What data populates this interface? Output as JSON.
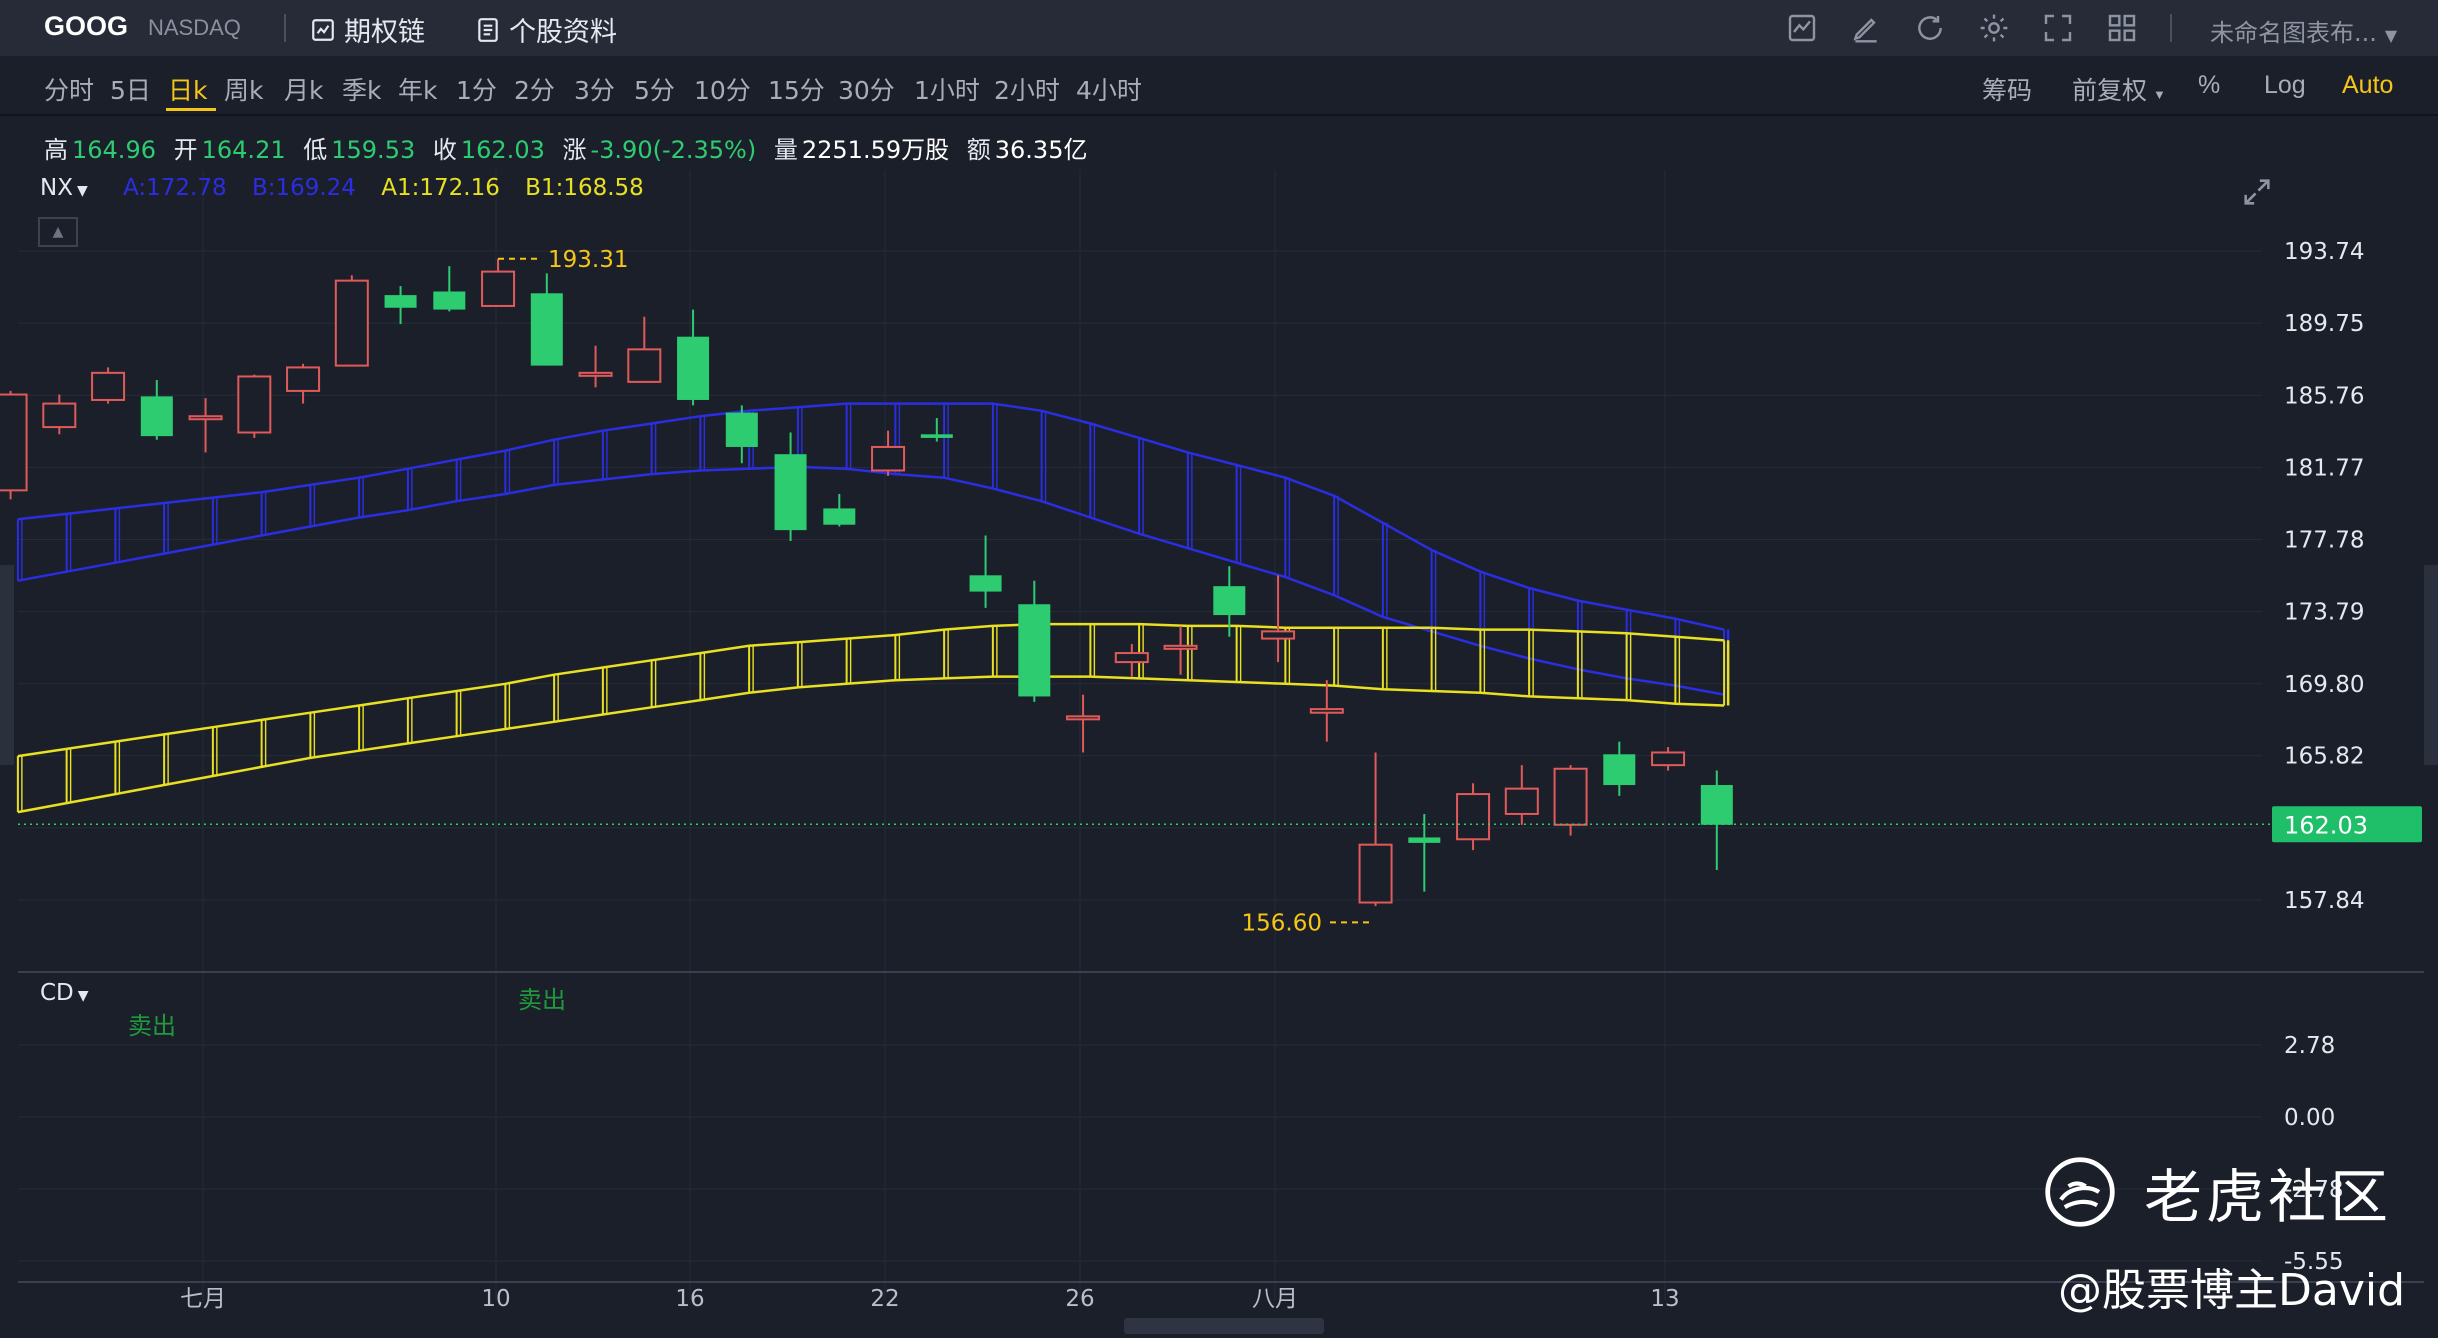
{
  "header": {
    "symbol": "GOOG",
    "exchange": "NASDAQ",
    "options_chain": "期权链",
    "profile": "个股资料",
    "layout_name": "未命名图表布...",
    "icons": [
      "indicator-icon",
      "draw-icon",
      "refresh-icon",
      "settings-icon",
      "fullscreen-icon",
      "layout-grid-icon"
    ]
  },
  "periods": [
    "分时",
    "5日",
    "日k",
    "周k",
    "月k",
    "季k",
    "年k",
    "1分",
    "2分",
    "3分",
    "5分",
    "10分",
    "15分",
    "30分",
    "1小时",
    "2小时",
    "4小时"
  ],
  "active_period": "日k",
  "right_tools": {
    "chips": "筹码",
    "adjust": "前复权",
    "percent": "%",
    "log": "Log",
    "auto": "Auto"
  },
  "quote": {
    "high_label": "高",
    "high": "164.96",
    "open_label": "开",
    "open": "164.21",
    "low_label": "低",
    "low": "159.53",
    "close_label": "收",
    "close": "162.03",
    "change_label": "涨",
    "change": "-3.90(-2.35%)",
    "volume_label": "量",
    "volume": "2251.59万股",
    "amount_label": "额",
    "amount": "36.35亿"
  },
  "indicator": {
    "name": "NX",
    "a": "A:172.78",
    "b": "B:169.24",
    "a1": "A1:172.16",
    "b1": "B1:168.58"
  },
  "sub_indicator": {
    "name": "CD",
    "signals": [
      "卖出",
      "卖出"
    ]
  },
  "price_axis": [
    "193.74",
    "189.75",
    "185.76",
    "181.77",
    "177.78",
    "173.79",
    "169.80",
    "165.82",
    "161.83",
    "157.84"
  ],
  "last_price": "162.03",
  "cd_axis": [
    "2.78",
    "0.00",
    "-2.78",
    "-5.55"
  ],
  "x_labels": [
    "七月",
    "10",
    "16",
    "22",
    "26",
    "八月",
    "13"
  ],
  "annotations": {
    "high_mark": "193.31",
    "low_mark": "156.60"
  },
  "watermark": {
    "brand": "老虎社区",
    "author": "@股票博主David"
  },
  "colors": {
    "up": "#e05a5a",
    "down": "#2ecc71",
    "band_blue": "#2a2ee0",
    "band_yellow": "#e8e020",
    "accent": "#f5c518"
  },
  "chart_data": {
    "type": "candlestick",
    "ylim": [
      155.0,
      195.0
    ],
    "candles": [
      {
        "o": 180.5,
        "h": 186.0,
        "l": 180.0,
        "c": 185.8
      },
      {
        "o": 184.0,
        "h": 185.8,
        "l": 183.6,
        "c": 185.3
      },
      {
        "o": 185.5,
        "h": 187.3,
        "l": 185.3,
        "c": 187.0
      },
      {
        "o": 185.7,
        "h": 186.6,
        "l": 183.3,
        "c": 183.5
      },
      {
        "o": 184.6,
        "h": 185.6,
        "l": 182.6,
        "c": 184.6
      },
      {
        "o": 183.7,
        "h": 186.9,
        "l": 183.4,
        "c": 186.8
      },
      {
        "o": 186.0,
        "h": 187.5,
        "l": 185.3,
        "c": 187.3
      },
      {
        "o": 187.4,
        "h": 192.4,
        "l": 187.4,
        "c": 192.1
      },
      {
        "o": 191.3,
        "h": 191.8,
        "l": 189.7,
        "c": 190.6
      },
      {
        "o": 191.5,
        "h": 192.9,
        "l": 190.4,
        "c": 190.5
      },
      {
        "o": 190.7,
        "h": 193.3,
        "l": 190.7,
        "c": 192.6
      },
      {
        "o": 191.4,
        "h": 192.5,
        "l": 187.4,
        "c": 187.4
      },
      {
        "o": 187.0,
        "h": 188.5,
        "l": 186.2,
        "c": 187.0
      },
      {
        "o": 186.5,
        "h": 190.1,
        "l": 186.5,
        "c": 188.3
      },
      {
        "o": 189.0,
        "h": 190.5,
        "l": 185.2,
        "c": 185.5
      },
      {
        "o": 184.8,
        "h": 185.2,
        "l": 182.0,
        "c": 182.9
      },
      {
        "o": 182.5,
        "h": 183.7,
        "l": 177.7,
        "c": 178.3
      },
      {
        "o": 179.5,
        "h": 180.3,
        "l": 178.5,
        "c": 178.6
      },
      {
        "o": 181.6,
        "h": 183.8,
        "l": 181.3,
        "c": 182.9
      },
      {
        "o": 183.6,
        "h": 184.5,
        "l": 183.2,
        "c": 183.4
      },
      {
        "o": 175.8,
        "h": 178.0,
        "l": 174.0,
        "c": 174.9
      },
      {
        "o": 174.2,
        "h": 175.5,
        "l": 168.8,
        "c": 169.1
      },
      {
        "o": 168.0,
        "h": 169.2,
        "l": 166.0,
        "c": 168.0
      },
      {
        "o": 171.0,
        "h": 172.0,
        "l": 170.2,
        "c": 171.5
      },
      {
        "o": 171.9,
        "h": 173.0,
        "l": 170.3,
        "c": 171.9
      },
      {
        "o": 175.2,
        "h": 176.3,
        "l": 172.4,
        "c": 173.6
      },
      {
        "o": 172.3,
        "h": 175.8,
        "l": 171.0,
        "c": 172.7
      },
      {
        "o": 168.2,
        "h": 170.0,
        "l": 166.6,
        "c": 168.4
      },
      {
        "o": 157.7,
        "h": 166.0,
        "l": 157.5,
        "c": 160.9
      },
      {
        "o": 161.3,
        "h": 162.6,
        "l": 158.3,
        "c": 161.0
      },
      {
        "o": 161.2,
        "h": 164.3,
        "l": 160.6,
        "c": 163.7
      },
      {
        "o": 162.6,
        "h": 165.3,
        "l": 162.0,
        "c": 164.0
      },
      {
        "o": 162.0,
        "h": 165.3,
        "l": 161.4,
        "c": 165.1
      },
      {
        "o": 165.9,
        "h": 166.6,
        "l": 163.6,
        "c": 164.2
      },
      {
        "o": 165.3,
        "h": 166.3,
        "l": 165.0,
        "c": 166.0
      },
      {
        "o": 164.2,
        "h": 165.0,
        "l": 159.5,
        "c": 162.0
      }
    ],
    "blue_upper": [
      178.9,
      179.2,
      179.5,
      179.8,
      180.1,
      180.4,
      180.8,
      181.2,
      181.7,
      182.2,
      182.7,
      183.3,
      183.8,
      184.2,
      184.6,
      184.9,
      185.1,
      185.3,
      185.3,
      185.3,
      185.3,
      184.9,
      184.2,
      183.4,
      182.6,
      181.9,
      181.2,
      180.2,
      178.7,
      177.2,
      176.0,
      175.1,
      174.4,
      173.9,
      173.4,
      172.8
    ],
    "blue_lower": [
      175.5,
      176.0,
      176.5,
      177.0,
      177.5,
      178.0,
      178.5,
      179.0,
      179.4,
      179.9,
      180.3,
      180.8,
      181.1,
      181.4,
      181.6,
      181.7,
      181.8,
      181.7,
      181.4,
      181.2,
      180.6,
      179.9,
      179.0,
      178.1,
      177.3,
      176.5,
      175.7,
      174.7,
      173.5,
      172.7,
      171.9,
      171.2,
      170.6,
      170.1,
      169.7,
      169.2
    ],
    "yellow_upper": [
      165.8,
      166.2,
      166.6,
      167.0,
      167.4,
      167.8,
      168.2,
      168.6,
      169.0,
      169.4,
      169.8,
      170.3,
      170.7,
      171.1,
      171.5,
      171.9,
      172.1,
      172.3,
      172.5,
      172.8,
      173.0,
      173.1,
      173.1,
      173.1,
      173.0,
      173.0,
      172.9,
      172.9,
      172.9,
      172.9,
      172.8,
      172.8,
      172.7,
      172.6,
      172.4,
      172.2
    ],
    "yellow_lower": [
      162.7,
      163.2,
      163.7,
      164.2,
      164.7,
      165.2,
      165.7,
      166.1,
      166.5,
      166.9,
      167.3,
      167.7,
      168.1,
      168.5,
      168.9,
      169.3,
      169.6,
      169.8,
      170.0,
      170.1,
      170.2,
      170.2,
      170.2,
      170.1,
      170.0,
      169.9,
      169.8,
      169.7,
      169.5,
      169.4,
      169.3,
      169.1,
      169.0,
      168.9,
      168.7,
      168.6
    ]
  }
}
